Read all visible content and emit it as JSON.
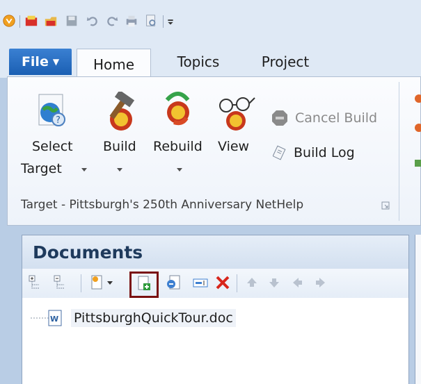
{
  "tabs": {
    "file": "File",
    "home": "Home",
    "topics": "Topics",
    "project": "Project"
  },
  "ribbon": {
    "select_target_line1": "Select",
    "select_target_line2": "Target",
    "build": "Build",
    "rebuild": "Rebuild",
    "view": "View",
    "cancel_build": "Cancel Build",
    "build_log": "Build Log",
    "group_label": "Target - Pittsburgh's 250th Anniversary NetHelp"
  },
  "documents": {
    "title": "Documents",
    "items": [
      {
        "label": "PittsburghQuickTour.doc"
      }
    ]
  },
  "colors": {
    "file_tab": "#2a6fc4",
    "highlight_border": "#7a1010",
    "cancel_icon": "#8a8a8a"
  },
  "icons": {
    "qat": [
      "app-orb-icon",
      "new-project-icon",
      "open-project-icon",
      "save-icon",
      "undo-icon",
      "redo-icon",
      "print-icon",
      "print-preview-icon",
      "customize-qat-icon"
    ],
    "doc_toolbar": [
      "expand-all-icon",
      "collapse-all-icon",
      "new-document-icon",
      "add-existing-document-icon",
      "import-document-icon",
      "rename-icon",
      "delete-icon",
      "move-up-icon",
      "move-down-icon",
      "move-left-icon",
      "move-right-icon"
    ]
  }
}
